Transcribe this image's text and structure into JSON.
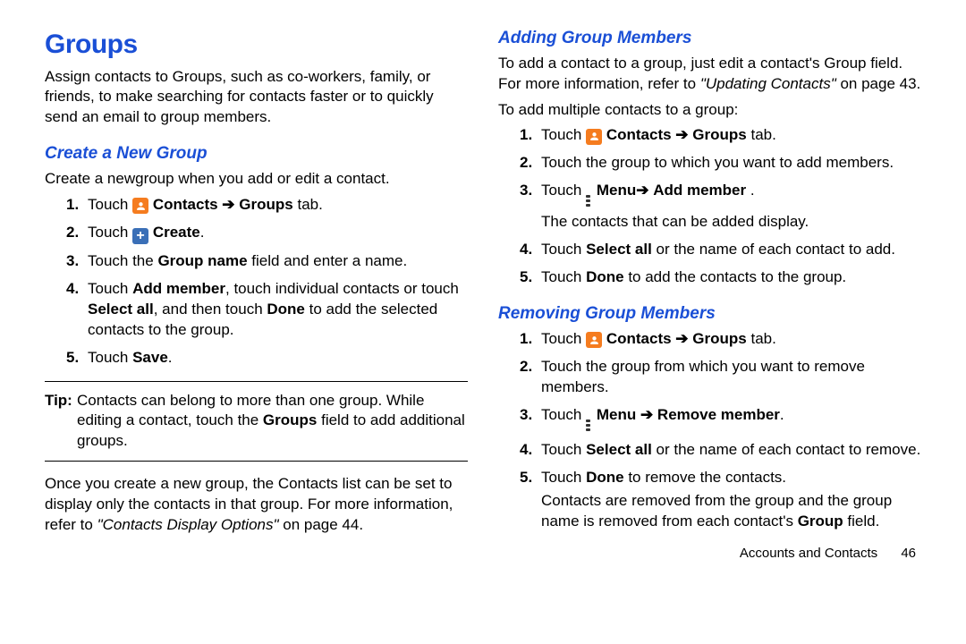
{
  "heading": "Groups",
  "intro": "Assign contacts to Groups, such as co-workers, family, or friends, to make searching for contacts faster or to quickly send an email to group members.",
  "sec_create": {
    "title": "Create a New Group",
    "lead": "Create a newgroup when you add or edit a contact.",
    "steps": {
      "s1a": "Touch ",
      "s1b": " Contacts",
      "s1c": "Groups",
      "s1d": " tab.",
      "s2a": "Touch ",
      "s2b": " Create",
      "s2c": ".",
      "s3a": "Touch the ",
      "s3b": "Group name",
      "s3c": " field and enter a name.",
      "s4a": "Touch ",
      "s4b": "Add member",
      "s4c": ", touch individual contacts or touch ",
      "s4d": "Select all",
      "s4e": ", and then touch ",
      "s4f": "Done",
      "s4g": " to add the selected contacts to the group.",
      "s5a": "Touch ",
      "s5b": "Save",
      "s5c": "."
    },
    "tip_label": "Tip:",
    "tip_a": " Contacts can belong to more than one group. While editing a contact, touch the ",
    "tip_b": "Groups",
    "tip_c": " field to add additional groups.",
    "after_a": "Once you create a new group, the Contacts list can be set to display only the contacts in that group. For more information, refer to ",
    "after_ref": "\"Contacts Display Options\"",
    "after_b": " on page 44."
  },
  "sec_add": {
    "title": "Adding Group Members",
    "lead_a": "To add a contact to a group, just edit a contact's Group field. For more information, refer to ",
    "lead_ref": "\"Updating Contacts\"",
    "lead_b": " on page 43.",
    "lead2": "To add multiple contacts to a group:",
    "steps": {
      "s1a": "Touch ",
      "s1b": " Contacts",
      "s1c": "Groups",
      "s1d": " tab.",
      "s2": "Touch the group to which you want to add members.",
      "s3a": "Touch ",
      "s3b": " Menu",
      "s3c": "Add member",
      "s3d": " .",
      "s3e": "The contacts that can be added display.",
      "s4a": "Touch ",
      "s4b": "Select all",
      "s4c": " or the name of each contact to add.",
      "s5a": "Touch ",
      "s5b": "Done",
      "s5c": " to add the contacts to the group."
    }
  },
  "sec_remove": {
    "title": "Removing Group Members",
    "steps": {
      "s1a": "Touch ",
      "s1b": " Contacts",
      "s1c": "Groups",
      "s1d": " tab.",
      "s2": "Touch the group from which you want to remove members.",
      "s3a": "Touch ",
      "s3b": " Menu ",
      "s3c": " Remove member",
      "s3d": ".",
      "s4a": "Touch ",
      "s4b": "Select all",
      "s4c": " or the name of each contact to remove.",
      "s5a": "Touch ",
      "s5b": "Done",
      "s5c": " to remove the contacts.",
      "after_a": "Contacts are removed from the group and the group name is removed from each contact's ",
      "after_b": "Group",
      "after_c": " field."
    }
  },
  "footer_section": "Accounts and Contacts",
  "footer_page": "46",
  "nums": {
    "n1": "1.",
    "n2": "2.",
    "n3": "3.",
    "n4": "4.",
    "n5": "5."
  },
  "arrow": "➔"
}
